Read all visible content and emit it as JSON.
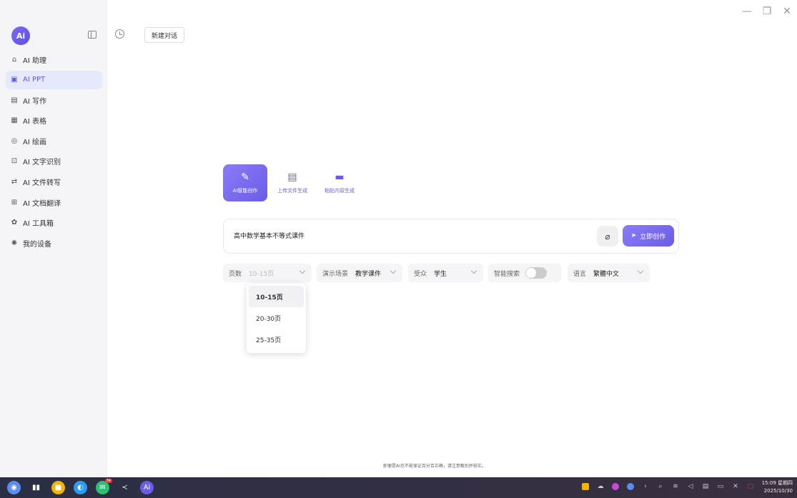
{
  "window": {
    "minimize": "—",
    "restore": "❐",
    "close": "✕"
  },
  "sidebar": {
    "logo": "Ai",
    "items": [
      {
        "label": "AI 助理",
        "icon": "robot-icon",
        "glyph": "⌂",
        "active": false
      },
      {
        "label": "AI PPT",
        "icon": "ppt-icon",
        "glyph": "▣",
        "active": true
      },
      {
        "label": "AI 写作",
        "icon": "writing-icon",
        "glyph": "▤",
        "active": false
      },
      {
        "label": "AI 表格",
        "icon": "table-icon",
        "glyph": "▦",
        "active": false
      },
      {
        "label": "AI 绘画",
        "icon": "palette-icon",
        "glyph": "◎",
        "active": false
      },
      {
        "label": "AI 文字识别",
        "icon": "ocr-icon",
        "glyph": "⊡",
        "active": false
      },
      {
        "label": "AI 文件转写",
        "icon": "transcribe-icon",
        "glyph": "⇄",
        "active": false
      },
      {
        "label": "AI 文档翻译",
        "icon": "translate-icon",
        "glyph": "⊞",
        "active": false
      },
      {
        "label": "AI 工具箱",
        "icon": "toolbox-icon",
        "glyph": "✿",
        "active": false
      },
      {
        "label": "我的设备",
        "icon": "device-icon",
        "glyph": "✺",
        "active": false
      }
    ]
  },
  "topbar": {
    "new_chat": "新建对话"
  },
  "modes": [
    {
      "label": "AI智能创作",
      "icon": "pen-icon",
      "glyph": "✎",
      "active": true
    },
    {
      "label": "上传文件生成",
      "icon": "file-icon",
      "glyph": "▤",
      "active": false
    },
    {
      "label": "粘贴内容生成",
      "icon": "chat-icon",
      "glyph": "▬",
      "active": false
    }
  ],
  "input": {
    "value": "高中数学基本不等式课件"
  },
  "create_button": {
    "label": "立即创作",
    "icon_glyph": "➤"
  },
  "attach_glyph": "⌀",
  "options": {
    "pages": {
      "label": "页数",
      "value": "10-15页"
    },
    "scene": {
      "label": "演示场景",
      "value": "教学课件"
    },
    "audience": {
      "label": "受众",
      "value": "学生"
    },
    "smart_search": {
      "label": "智能搜索",
      "on": false
    },
    "language": {
      "label": "语言",
      "value": "繁體中文"
    }
  },
  "dropdown": {
    "items": [
      "10-15页",
      "20-30页",
      "25-35页"
    ],
    "selected_index": 0
  },
  "disclaimer": "即便是AI也不能保证百分百正确，请注意甄别并核实。",
  "taskbar": {
    "apps": [
      {
        "name": "launcher-icon",
        "glyph": "◉",
        "color": "#5b8def"
      },
      {
        "name": "multitask-icon",
        "glyph": "▮▮",
        "color": "transparent"
      },
      {
        "name": "files-icon",
        "glyph": "■",
        "color": "#f5b400"
      },
      {
        "name": "browser-icon",
        "glyph": "◐",
        "color": "#2b9cf0"
      },
      {
        "name": "chat-app-icon",
        "glyph": "✉",
        "color": "#2fbf71",
        "badge": "34"
      },
      {
        "name": "vscode-icon",
        "glyph": "≺",
        "color": "transparent"
      },
      {
        "name": "ai-app-icon",
        "glyph": "Ai",
        "color": "#6a5ce8"
      }
    ],
    "clock_time": "15:09 星期四",
    "clock_date": "2025/10/30"
  }
}
